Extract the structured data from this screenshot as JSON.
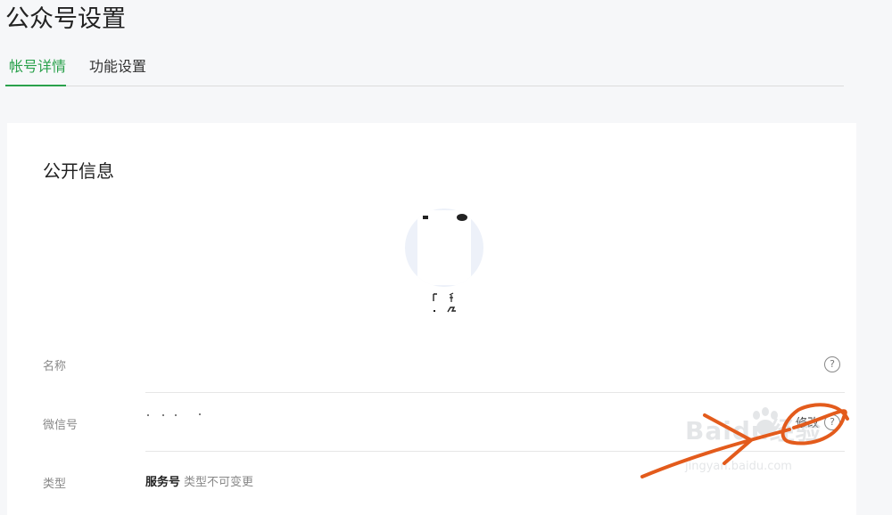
{
  "page": {
    "title": "公众号设置"
  },
  "tabs": [
    {
      "label": "帐号详情",
      "active": true
    },
    {
      "label": "功能设置",
      "active": false
    }
  ],
  "section": {
    "title": "公开信息"
  },
  "rows": {
    "name": {
      "label": "名称"
    },
    "wechat_id": {
      "label": "微信号",
      "edit_label": "修改"
    },
    "type": {
      "label": "类型",
      "value": "服务号",
      "note": "类型不可变更"
    }
  },
  "help_glyph": "?",
  "watermark": {
    "main": "Baidu经验",
    "sub": "jingyan.baidu.com"
  },
  "colors": {
    "accent_green": "#2aa14c",
    "annotation_orange": "#e35b1c"
  }
}
